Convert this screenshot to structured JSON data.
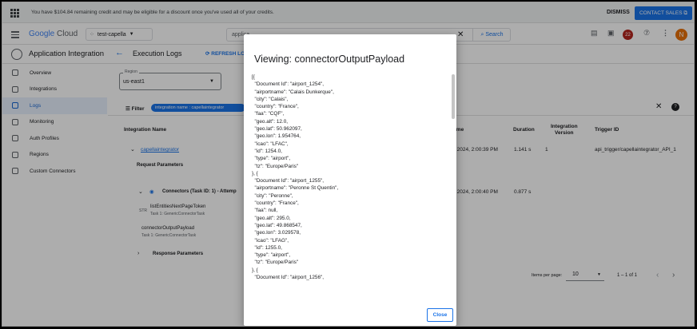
{
  "banner": {
    "message": "You have $104.84 remaining credit and may be eligible for a discount once you've used all of your credits.",
    "dismiss": "DISMISS",
    "contact": "CONTACT SALES ⧉"
  },
  "header": {
    "logo_google": "Google",
    "logo_cloud": "Cloud",
    "project": "test-capella",
    "search_value": "applica",
    "search_button": "Search",
    "notification_count": "22",
    "avatar_letter": "N"
  },
  "appbar": {
    "app_title": "Application Integration",
    "page_title": "Execution Logs",
    "refresh": "REFRESH LO"
  },
  "sidebar": {
    "items": [
      {
        "label": "Overview",
        "icon": "overview-icon"
      },
      {
        "label": "Integrations",
        "icon": "integrations-icon"
      },
      {
        "label": "Logs",
        "icon": "logs-icon"
      },
      {
        "label": "Monitoring",
        "icon": "monitoring-icon"
      },
      {
        "label": "Auth Profiles",
        "icon": "shield-icon"
      },
      {
        "label": "Regions",
        "icon": "globe-icon"
      },
      {
        "label": "Custom Connectors",
        "icon": "connector-icon"
      }
    ]
  },
  "main": {
    "region_label": "Region",
    "region_value": "us-east1",
    "filter_label": "Filter",
    "filter_chip": "integration name : capellaintegrator",
    "columns": {
      "integration_name": "Integration Name",
      "time": "ime",
      "duration": "Duration",
      "version_line1": "Integration",
      "version_line2": "Version",
      "trigger_id": "Trigger ID"
    },
    "row1": {
      "name": "capellaintegrator",
      "time": ", 2024, 2:00:39 PM",
      "duration": "1.141 s",
      "version": "1",
      "trigger": "api_trigger/capellaintegrator_API_1"
    },
    "request_parameters": "Request Parameters",
    "task_row": {
      "name": "Connectors (Task ID: 1) - Attemp",
      "time": ", 2024, 2:00:40 PM",
      "duration": "0.877 s"
    },
    "var1": {
      "name": "listEntitiesNextPageToken",
      "type": "Task 1: GenericConnectorTask",
      "prefix": "STR"
    },
    "var2": {
      "name": "connectorOutputPayload",
      "type": "Task 1: GenericConnectorTask"
    },
    "response_parameters": "Response Parameters",
    "pager": {
      "items_per_page_label": "Items per page:",
      "items_per_page_value": "10",
      "range": "1 – 1 of 1"
    }
  },
  "dialog": {
    "title": "Viewing: connectorOutputPayload",
    "payload": "[{\n  \"Document Id\": \"airport_1254\",\n  \"airportname\": \"Calais Dunkerque\",\n  \"city\": \"Calais\",\n  \"country\": \"France\",\n  \"faa\": \"CQF\",\n  \"geo.alt\": 12.0,\n  \"geo.lat\": 50.962097,\n  \"geo.lon\": 1.954764,\n  \"icao\": \"LFAC\",\n  \"id\": 1254.0,\n  \"type\": \"airport\",\n  \"tz\": \"Europe/Paris\"\n}, {\n  \"Document Id\": \"airport_1255\",\n  \"airportname\": \"Peronne St Quentin\",\n  \"city\": \"Peronne\",\n  \"country\": \"France\",\n  \"faa\": null,\n  \"geo.alt\": 295.0,\n  \"geo.lat\": 49.868547,\n  \"geo.lon\": 3.029578,\n  \"icao\": \"LFAG\",\n  \"id\": 1255.0,\n  \"type\": \"airport\",\n  \"tz\": \"Europe/Paris\"\n}, {\n  \"Document Id\": \"airport_1256\",",
    "close": "Close"
  }
}
